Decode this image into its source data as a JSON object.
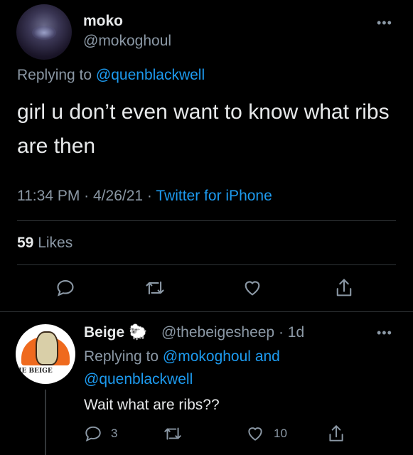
{
  "tweet": {
    "author_name": "moko",
    "author_handle": "@mokoghoul",
    "replying_prefix": "Replying to",
    "replying_to": "@quenblackwell",
    "text": "girl u don’t even want to know what ribs are then",
    "time": "11:34 PM",
    "date": "4/26/21",
    "source": "Twitter for iPhone",
    "likes_count": "59",
    "likes_label": "Likes",
    "more": "•••"
  },
  "reply": {
    "author_name": "Beige",
    "author_emoji": "🐑",
    "author_handle": "@thebeigesheep",
    "age": "1d",
    "replying_prefix": "Replying to",
    "replying_to_1": "@mokoghoul",
    "and_word": "and",
    "replying_to_2": "@quenblackwell",
    "text": "Wait what are ribs??",
    "reply_count": "3",
    "like_count": "10",
    "avatar_banner": "HE BEIGE",
    "more": "•••"
  },
  "colors": {
    "background": "#000000",
    "text": "#e7e9ea",
    "secondary": "#8b98a5",
    "link": "#1d9bf0",
    "divider": "#2f3336"
  }
}
